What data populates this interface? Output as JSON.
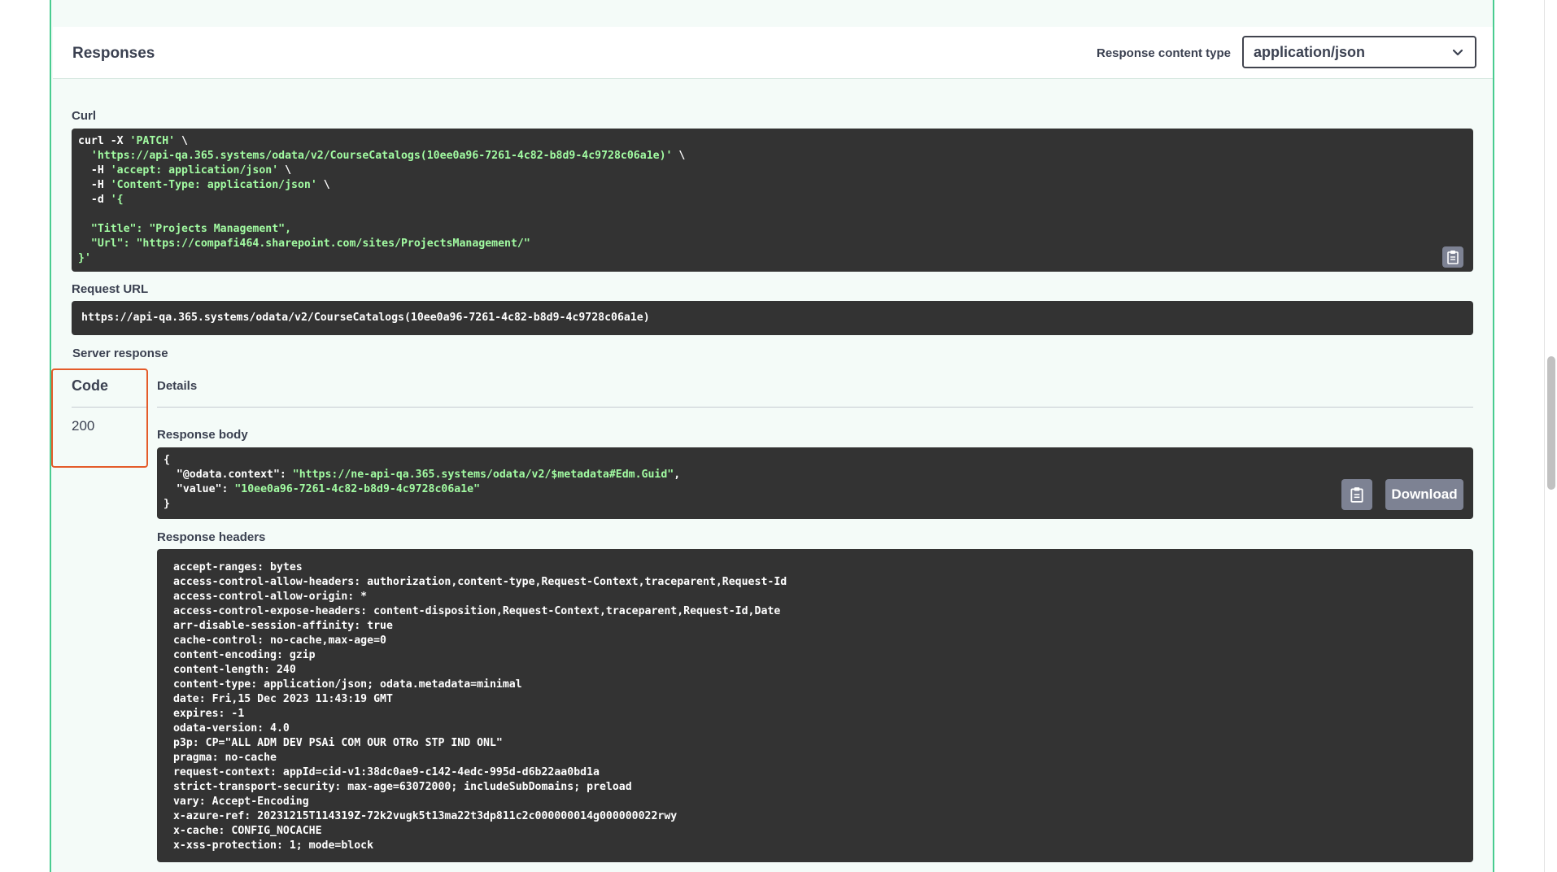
{
  "responses": {
    "title": "Responses",
    "content_type_label": "Response content type",
    "content_type_value": "application/json"
  },
  "curl": {
    "label": "Curl",
    "lines": [
      [
        "curl -X ",
        "'PATCH'",
        " \\"
      ],
      [
        "  ",
        "'https://api-qa.365.systems/odata/v2/CourseCatalogs(10ee0a96-7261-4c82-b8d9-4c9728c06a1e)'",
        " \\"
      ],
      [
        "  -H ",
        "'accept: application/json'",
        " \\"
      ],
      [
        "  -H ",
        "'Content-Type: application/json'",
        " \\"
      ],
      [
        "  -d ",
        "'{",
        ""
      ],
      [
        "",
        "",
        ""
      ],
      [
        "  ",
        "\"Title\": \"Projects Management\",",
        ""
      ],
      [
        "  ",
        "\"Url\": \"https://compafi464.sharepoint.com/sites/ProjectsManagement/\"",
        ""
      ],
      [
        "",
        "}'",
        ""
      ]
    ]
  },
  "request_url": {
    "label": "Request URL",
    "value": "https://api-qa.365.systems/odata/v2/CourseCatalogs(10ee0a96-7261-4c82-b8d9-4c9728c06a1e)"
  },
  "server_response": {
    "label": "Server response",
    "code_header": "Code",
    "details_header": "Details",
    "code_value": "200",
    "body_label": "Response body",
    "body_lines": [
      [
        "{",
        "",
        ""
      ],
      [
        "  \"@odata.context\": ",
        "\"https://ne-api-qa.365.systems/odata/v2/$metadata#Edm.Guid\"",
        ","
      ],
      [
        "  \"value\": ",
        "\"10ee0a96-7261-4c82-b8d9-4c9728c06a1e\"",
        ""
      ],
      [
        "}",
        "",
        ""
      ]
    ],
    "download_label": "Download",
    "headers_label": "Response headers",
    "headers_lines": [
      " accept-ranges: bytes",
      " access-control-allow-headers: authorization,content-type,Request-Context,traceparent,Request-Id",
      " access-control-allow-origin: *",
      " access-control-expose-headers: content-disposition,Request-Context,traceparent,Request-Id,Date",
      " arr-disable-session-affinity: true",
      " cache-control: no-cache,max-age=0",
      " content-encoding: gzip",
      " content-length: 240",
      " content-type: application/json; odata.metadata=minimal",
      " date: Fri,15 Dec 2023 11:43:19 GMT",
      " expires: -1",
      " odata-version: 4.0",
      " p3p: CP=\"ALL ADM DEV PSAi COM OUR OTRo STP IND ONL\"",
      " pragma: no-cache",
      " request-context: appId=cid-v1:38dc0ae9-c142-4edc-995d-d6b22aa0bd1a",
      " strict-transport-security: max-age=63072000; includeSubDomains; preload",
      " vary: Accept-Encoding",
      " x-azure-ref: 20231215T114319Z-72k2vugk5t13ma22t3dp811c2c000000014g000000022rwy",
      " x-cache: CONFIG_NOCACHE",
      " x-xss-protection: 1; mode=block"
    ]
  },
  "icons": {
    "copy": "clipboard-icon",
    "dropdown": "chevron-down-icon"
  },
  "colors": {
    "accent_green": "#49cc90",
    "code_bg": "#333333",
    "string_green": "#a2fca2",
    "highlight_orange": "#e45b2a"
  }
}
